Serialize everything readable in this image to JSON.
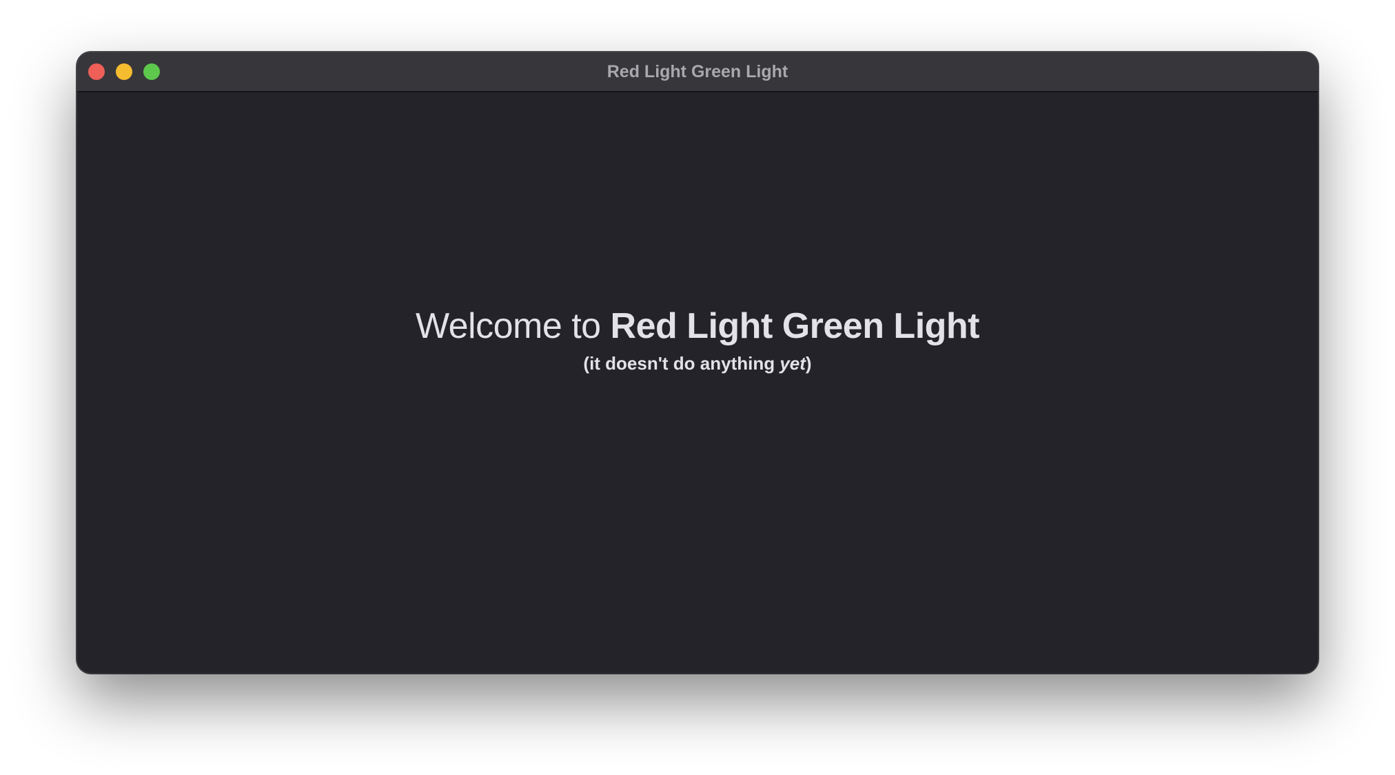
{
  "window": {
    "title": "Red Light Green Light"
  },
  "content": {
    "welcome_prefix": "Welcome to ",
    "app_name": "Red Light Green Light",
    "subtitle_open": "(it doesn't do anything ",
    "subtitle_emphasis": "yet",
    "subtitle_close": ")"
  },
  "icons": {
    "close": "close-traffic-light",
    "minimize": "minimize-traffic-light",
    "zoom": "zoom-traffic-light"
  },
  "colors": {
    "close": "#ee5f57",
    "minimize": "#f6bc2f",
    "zoom": "#5dc84c",
    "window_background": "#242329",
    "titlebar_background": "#37363b"
  }
}
